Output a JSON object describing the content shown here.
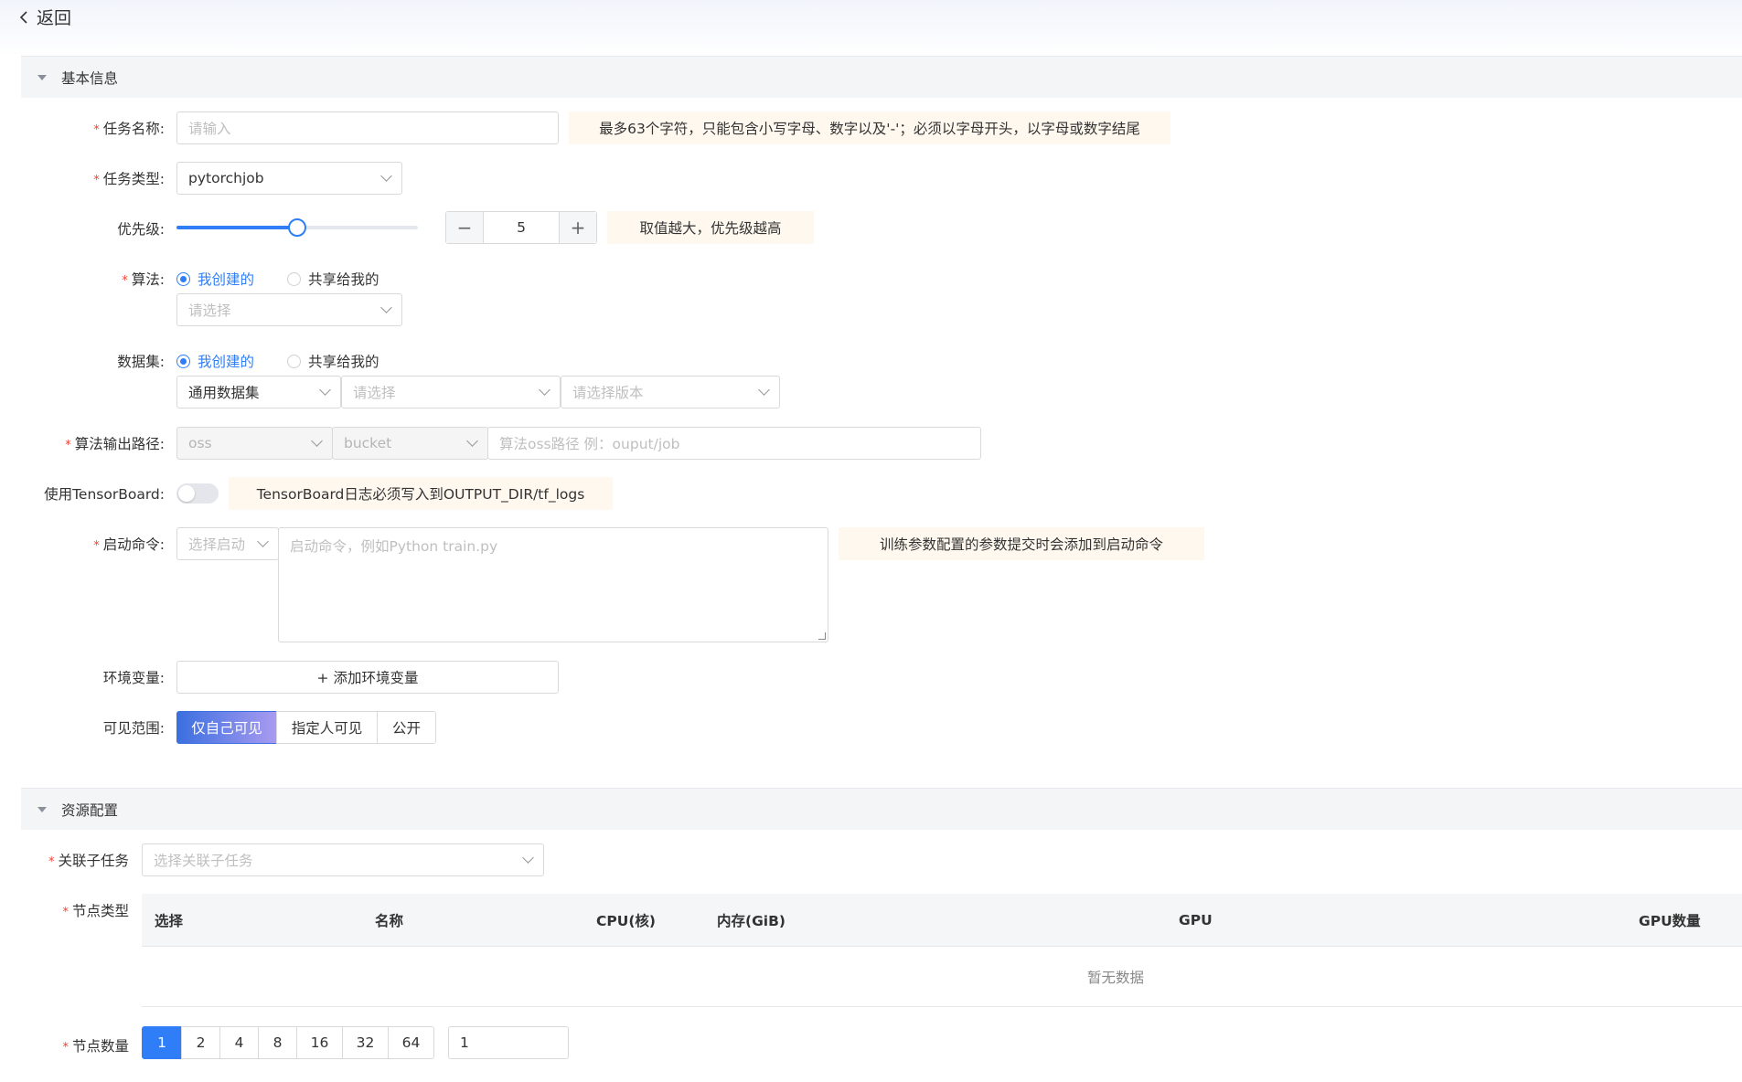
{
  "header": {
    "back_label": "返回"
  },
  "basic": {
    "title": "基本信息",
    "task_name": {
      "label": "任务名称:",
      "placeholder": "请输入",
      "hint": "最多63个字符，只能包含小写字母、数字以及'-'；必须以字母开头，以字母或数字结尾"
    },
    "task_type": {
      "label": "任务类型:",
      "value": "pytorchjob"
    },
    "priority": {
      "label": "优先级:",
      "value": "5",
      "level": 0.5,
      "minus": "−",
      "plus": "+",
      "hint": "取值越大，优先级越高"
    },
    "algorithm": {
      "label": "算法:",
      "radio_mine": "我创建的",
      "radio_shared": "共享给我的",
      "placeholder": "请选择"
    },
    "dataset": {
      "label": "数据集:",
      "radio_mine": "我创建的",
      "radio_shared": "共享给我的",
      "type_value": "通用数据集",
      "placeholder": "请选择",
      "version_placeholder": "请选择版本"
    },
    "output": {
      "label": "算法输出路径:",
      "storage": "oss",
      "bucket": "bucket",
      "placeholder": "算法oss路径 例：ouput/job"
    },
    "tensorboard": {
      "label": "使用TensorBoard:",
      "enabled": false,
      "hint": "TensorBoard日志必须写入到OUTPUT_DIR/tf_logs"
    },
    "command": {
      "label": "启动命令:",
      "select_placeholder": "选择启动",
      "placeholder": "启动命令，例如Python train.py",
      "hint": "训练参数配置的参数提交时会添加到启动命令"
    },
    "env": {
      "label": "环境变量:",
      "add_label": "+ 添加环境变量"
    },
    "visibility": {
      "label": "可见范围:",
      "options": [
        "仅自己可见",
        "指定人可见",
        "公开"
      ],
      "selected": "仅自己可见"
    }
  },
  "resource": {
    "title": "资源配置",
    "subtask": {
      "label": "关联子任务",
      "placeholder": "选择关联子任务"
    },
    "node_type": {
      "label": "节点类型",
      "columns": [
        "选择",
        "名称",
        "CPU(核)",
        "内存(GiB)",
        "GPU",
        "GPU数量"
      ],
      "empty_text": "暂无数据"
    },
    "node_count": {
      "label": "节点数量",
      "options": [
        "1",
        "2",
        "4",
        "8",
        "16",
        "32",
        "64"
      ],
      "selected": "1",
      "custom_value": "1"
    }
  },
  "colors": {
    "primary": "#2f7ef7",
    "required": "#f04134",
    "hint_bg": "#fff8ef"
  }
}
